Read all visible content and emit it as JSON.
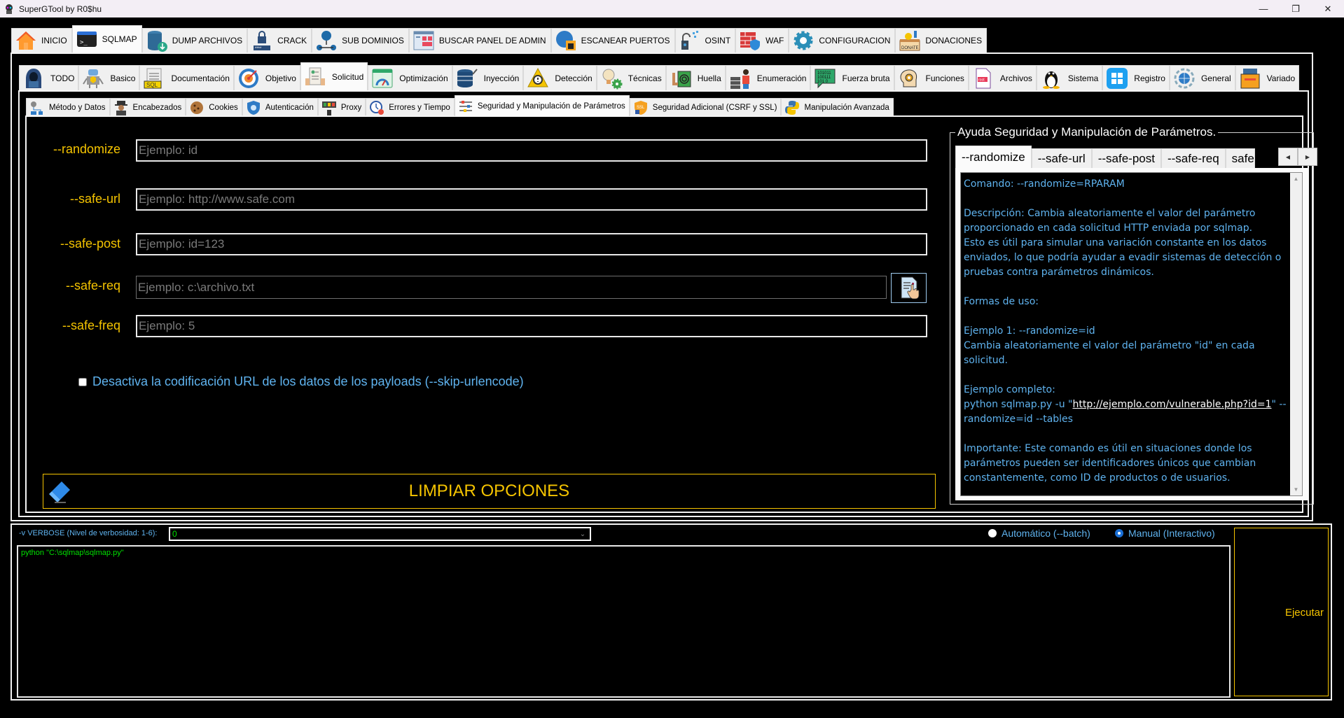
{
  "window": {
    "title": "SuperGTool by R0$hu",
    "controls": [
      "minimize",
      "restore",
      "close"
    ]
  },
  "main_tabs": [
    {
      "label": "INICIO",
      "icon": "home-icon"
    },
    {
      "label": "SQLMAP",
      "icon": "terminal-icon",
      "active": true
    },
    {
      "label": "DUMP ARCHIVOS",
      "icon": "database-download-icon"
    },
    {
      "label": "CRACK",
      "icon": "password-crack-icon"
    },
    {
      "label": "SUB DOMINIOS",
      "icon": "network-globe-icon"
    },
    {
      "label": "BUSCAR PANEL DE ADMIN",
      "icon": "admin-panel-icon"
    },
    {
      "label": "ESCANEAR PUERTOS",
      "icon": "port-scan-icon"
    },
    {
      "label": "OSINT",
      "icon": "unlock-osint-icon"
    },
    {
      "label": "WAF",
      "icon": "firewall-icon"
    },
    {
      "label": "CONFIGURACION",
      "icon": "gear-icon"
    },
    {
      "label": "DONACIONES",
      "icon": "donate-box-icon"
    }
  ],
  "sqlmap_tabs": [
    {
      "label": "TODO",
      "icon": "hacker-hood-icon"
    },
    {
      "label": "Basico",
      "icon": "robot-icon"
    },
    {
      "label": "Documentación",
      "icon": "sql-doc-icon"
    },
    {
      "label": "Objetivo",
      "icon": "target-icon"
    },
    {
      "label": "Solicitud",
      "icon": "request-form-icon",
      "active": true
    },
    {
      "label": "Optimización",
      "icon": "speed-gauge-icon"
    },
    {
      "label": "Inyección",
      "icon": "db-injection-icon"
    },
    {
      "label": "Detección",
      "icon": "warning-magnifier-icon"
    },
    {
      "label": "Técnicas",
      "icon": "idea-gear-icon"
    },
    {
      "label": "Huella",
      "icon": "fingerprint-icon"
    },
    {
      "label": "Enumeración",
      "icon": "server-user-icon"
    },
    {
      "label": "Fuerza bruta",
      "icon": "binary-bubble-icon"
    },
    {
      "label": "Funciones",
      "icon": "head-gear-icon"
    },
    {
      "label": "Archivos",
      "icon": "root-file-icon"
    },
    {
      "label": "Sistema",
      "icon": "linux-tux-icon"
    },
    {
      "label": "Registro",
      "icon": "windows-icon"
    },
    {
      "label": "General",
      "icon": "globe-cycle-icon"
    },
    {
      "label": "Variado",
      "icon": "toolbox-icon"
    }
  ],
  "request_tabs": [
    {
      "label": "Método y Datos",
      "icon": "method-gear-icon"
    },
    {
      "label": "Encabezados",
      "icon": "spy-icon"
    },
    {
      "label": "Cookies",
      "icon": "cookie-icon"
    },
    {
      "label": "Autenticación",
      "icon": "shield-check-icon"
    },
    {
      "label": "Proxy",
      "icon": "proxy-server-icon"
    },
    {
      "label": "Errores y Tiempo",
      "icon": "clock-error-icon"
    },
    {
      "label": "Seguridad y Manipulación de Parámetros",
      "icon": "sliders-icon",
      "active": true
    },
    {
      "label": "Seguridad Adicional (CSRF y SSL)",
      "icon": "ssl-shield-icon"
    },
    {
      "label": "Manipulación Avanzada",
      "icon": "python-icon"
    }
  ],
  "form": {
    "fields": [
      {
        "label": "--randomize",
        "value": "",
        "placeholder": "Ejemplo: id"
      },
      {
        "label": "--safe-url",
        "value": "",
        "placeholder": "Ejemplo: http://www.safe.com"
      },
      {
        "label": "--safe-post",
        "value": "",
        "placeholder": "Ejemplo: id=123"
      },
      {
        "label": "--safe-req",
        "value": "",
        "placeholder": "Ejemplo: c:\\archivo.txt"
      },
      {
        "label": "--safe-freq",
        "value": "",
        "placeholder": "Ejemplo: 5"
      }
    ],
    "skip_urlencode": {
      "label": "Desactiva la codificación URL de los datos de los payloads (--skip-urlencode)",
      "checked": false
    },
    "clear_button": "LIMPIAR OPCIONES"
  },
  "help": {
    "title": "Ayuda Seguridad y Manipulación de Parámetros.",
    "tabs": [
      "--randomize",
      "--safe-url",
      "--safe-post",
      "--safe-req",
      "--safe-freq"
    ],
    "active_tab": "--randomize",
    "lines": [
      "Comando: --randomize=RPARAM",
      "",
      "Descripción: Cambia aleatoriamente el valor del parámetro",
      "proporcionado en cada solicitud HTTP enviada por sqlmap.",
      "Esto es útil para simular una variación constante en los datos",
      "enviados, lo que podría ayudar a evadir sistemas de detección o",
      "pruebas contra parámetros dinámicos.",
      "",
      "Formas de uso:",
      "",
      "Ejemplo 1: --randomize=id",
      "Cambia aleatoriamente el valor del parámetro \"id\" en cada",
      "solicitud.",
      "",
      "Ejemplo completo:"
    ],
    "example_prefix": "python sqlmap.py -u \"",
    "example_link": "http://ejemplo.com/vulnerable.php?id=1",
    "example_suffix": "\" --",
    "example_line2": "randomize=id --tables",
    "lines_after": [
      "",
      "Importante: Este comando es útil en situaciones donde los",
      "parámetros pueden ser identificadores únicos que cambian",
      "constantemente, como ID de productos o de usuarios."
    ]
  },
  "bottom": {
    "verbose_label": "-v VERBOSE (Nivel de verbosidad: 1-6):",
    "verbose_value": "0",
    "mode_options": [
      {
        "label": "Automático (--batch)",
        "selected": false
      },
      {
        "label": "Manual (Interactivo)",
        "selected": true
      }
    ],
    "console_command": "python \"C:\\sqlmap\\sqlmap.py\"",
    "execute_button": "Ejecutar"
  },
  "colors": {
    "accent_yellow": "#f5c400",
    "text_blue": "#5fb3ef",
    "console_green": "#00e000",
    "background": "#000000"
  }
}
